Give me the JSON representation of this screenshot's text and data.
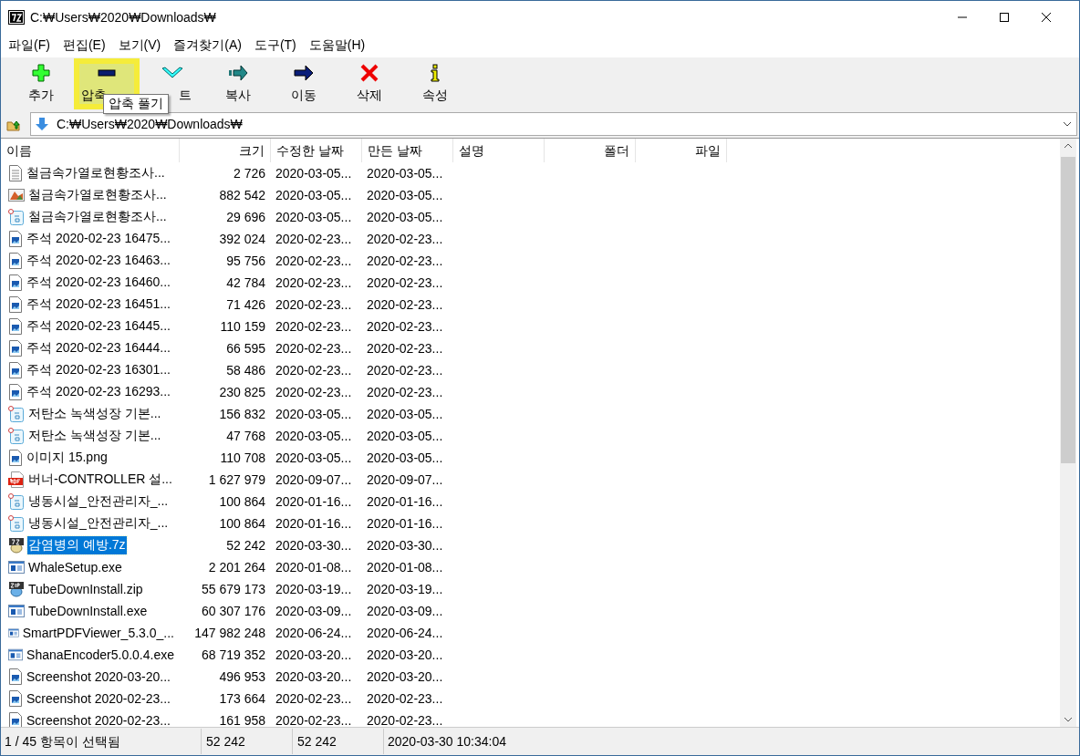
{
  "window": {
    "title": "C:₩Users₩2020₩Downloads₩"
  },
  "menu": [
    "파일(F)",
    "편집(E)",
    "보기(V)",
    "즐겨찾기(A)",
    "도구(T)",
    "도움말(H)"
  ],
  "toolbar": [
    {
      "kind": "add",
      "label": "추가",
      "selected": false
    },
    {
      "kind": "extract",
      "label": "압축",
      "selected": true
    },
    {
      "kind": "test",
      "label": "트",
      "selected": false
    },
    {
      "kind": "copy",
      "label": "복사",
      "selected": false
    },
    {
      "kind": "move",
      "label": "이동",
      "selected": false
    },
    {
      "kind": "delete",
      "label": "삭제",
      "selected": false
    },
    {
      "kind": "info",
      "label": "속성",
      "selected": false
    }
  ],
  "tooltip": "압축 풀기",
  "address": {
    "value": "C:₩Users₩2020₩Downloads₩"
  },
  "table": {
    "columns": [
      "이름",
      "크기",
      "수정한 날짜",
      "만든 날짜",
      "설명",
      "폴더",
      "파일"
    ],
    "rows": [
      {
        "kind": "text",
        "name": "철금속가열로현황조사...",
        "size": "2 726",
        "modified": "2020-03-05...",
        "created": "2020-03-05...",
        "selected": false
      },
      {
        "kind": "picture",
        "name": "철금속가열로현황조사...",
        "size": "882 542",
        "modified": "2020-03-05...",
        "created": "2020-03-05...",
        "selected": false
      },
      {
        "kind": "hwp",
        "name": "철금속가열로현황조사...",
        "size": "29 696",
        "modified": "2020-03-05...",
        "created": "2020-03-05...",
        "selected": false
      },
      {
        "kind": "image",
        "name": "주석 2020-02-23 16475...",
        "size": "392 024",
        "modified": "2020-02-23...",
        "created": "2020-02-23...",
        "selected": false
      },
      {
        "kind": "image",
        "name": "주석 2020-02-23 16463...",
        "size": "95 756",
        "modified": "2020-02-23...",
        "created": "2020-02-23...",
        "selected": false
      },
      {
        "kind": "image",
        "name": "주석 2020-02-23 16460...",
        "size": "42 784",
        "modified": "2020-02-23...",
        "created": "2020-02-23...",
        "selected": false
      },
      {
        "kind": "image",
        "name": "주석 2020-02-23 16451...",
        "size": "71 426",
        "modified": "2020-02-23...",
        "created": "2020-02-23...",
        "selected": false
      },
      {
        "kind": "image",
        "name": "주석 2020-02-23 16445...",
        "size": "110 159",
        "modified": "2020-02-23...",
        "created": "2020-02-23...",
        "selected": false
      },
      {
        "kind": "image",
        "name": "주석 2020-02-23 16444...",
        "size": "66 595",
        "modified": "2020-02-23...",
        "created": "2020-02-23...",
        "selected": false
      },
      {
        "kind": "image",
        "name": "주석 2020-02-23 16301...",
        "size": "58 486",
        "modified": "2020-02-23...",
        "created": "2020-02-23...",
        "selected": false
      },
      {
        "kind": "image",
        "name": "주석 2020-02-23 16293...",
        "size": "230 825",
        "modified": "2020-02-23...",
        "created": "2020-02-23...",
        "selected": false
      },
      {
        "kind": "hwp",
        "name": "저탄소 녹색성장 기본...",
        "size": "156 832",
        "modified": "2020-03-05...",
        "created": "2020-03-05...",
        "selected": false
      },
      {
        "kind": "hwp",
        "name": "저탄소 녹색성장 기본...",
        "size": "47 768",
        "modified": "2020-03-05...",
        "created": "2020-03-05...",
        "selected": false
      },
      {
        "kind": "image",
        "name": "이미지 15.png",
        "size": "110 708",
        "modified": "2020-03-05...",
        "created": "2020-03-05...",
        "selected": false
      },
      {
        "kind": "pdf",
        "name": "버너-CONTROLLER 설...",
        "size": "1 627 979",
        "modified": "2020-09-07...",
        "created": "2020-09-07...",
        "selected": false
      },
      {
        "kind": "hwp",
        "name": "냉동시설_안전관리자_...",
        "size": "100 864",
        "modified": "2020-01-16...",
        "created": "2020-01-16...",
        "selected": false
      },
      {
        "kind": "hwp",
        "name": "냉동시설_안전관리자_...",
        "size": "100 864",
        "modified": "2020-01-16...",
        "created": "2020-01-16...",
        "selected": false
      },
      {
        "kind": "archive",
        "name": "감염병의 예방.7z",
        "size": "52 242",
        "modified": "2020-03-30...",
        "created": "2020-03-30...",
        "selected": true
      },
      {
        "kind": "exe",
        "name": "WhaleSetup.exe",
        "size": "2 201 264",
        "modified": "2020-01-08...",
        "created": "2020-01-08...",
        "selected": false
      },
      {
        "kind": "zip",
        "name": "TubeDownInstall.zip",
        "size": "55 679 173",
        "modified": "2020-03-19...",
        "created": "2020-03-19...",
        "selected": false
      },
      {
        "kind": "exe",
        "name": "TubeDownInstall.exe",
        "size": "60 307 176",
        "modified": "2020-03-09...",
        "created": "2020-03-09...",
        "selected": false
      },
      {
        "kind": "exe",
        "name": "SmartPDFViewer_5.3.0_...",
        "size": "147 982 248",
        "modified": "2020-06-24...",
        "created": "2020-06-24...",
        "selected": false
      },
      {
        "kind": "exe",
        "name": "ShanaEncoder5.0.0.4.exe",
        "size": "68 719 352",
        "modified": "2020-03-20...",
        "created": "2020-03-20...",
        "selected": false
      },
      {
        "kind": "image",
        "name": "Screenshot 2020-03-20...",
        "size": "496 953",
        "modified": "2020-03-20...",
        "created": "2020-03-20...",
        "selected": false
      },
      {
        "kind": "image",
        "name": "Screenshot 2020-02-23...",
        "size": "173 664",
        "modified": "2020-02-23...",
        "created": "2020-02-23...",
        "selected": false
      },
      {
        "kind": "image",
        "name": "Screenshot 2020-02-23...",
        "size": "161 958",
        "modified": "2020-02-23...",
        "created": "2020-02-23...",
        "selected": false
      }
    ]
  },
  "status_bar": [
    "1 / 45 항목이 선택됨",
    "52 242",
    "52 242",
    "2020-03-30 10:34:04"
  ]
}
